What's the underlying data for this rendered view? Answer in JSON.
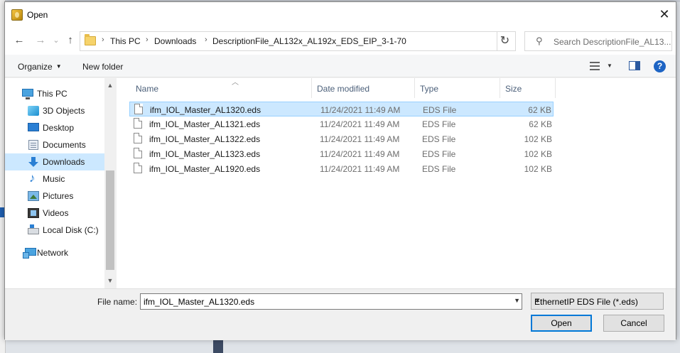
{
  "dialog": {
    "title": "Open",
    "close_glyph": "✕"
  },
  "nav": {
    "back_glyph": "←",
    "forward_glyph": "→",
    "up_glyph": "↑",
    "recent_glyph": "⌄",
    "refresh_glyph": "↻"
  },
  "address": {
    "crumbs": [
      "This PC",
      "Downloads",
      "DescriptionFile_AL132x_AL192x_EDS_EIP_3-1-70"
    ],
    "separator": "›"
  },
  "search": {
    "placeholder": "Search DescriptionFile_AL13...",
    "icon": "search-icon"
  },
  "toolbar": {
    "organize": "Organize",
    "new_folder": "New folder",
    "help": "?"
  },
  "sidebar": {
    "items": [
      {
        "label": "This PC",
        "icon": "computer-icon"
      },
      {
        "label": "3D Objects",
        "icon": "cube-icon"
      },
      {
        "label": "Desktop",
        "icon": "desktop-icon"
      },
      {
        "label": "Documents",
        "icon": "documents-icon"
      },
      {
        "label": "Downloads",
        "icon": "download-icon",
        "selected": true
      },
      {
        "label": "Music",
        "icon": "music-icon"
      },
      {
        "label": "Pictures",
        "icon": "pictures-icon"
      },
      {
        "label": "Videos",
        "icon": "videos-icon"
      },
      {
        "label": "Local Disk (C:)",
        "icon": "disk-icon"
      },
      {
        "label": "Network",
        "icon": "network-icon"
      }
    ]
  },
  "columns": {
    "name": "Name",
    "date": "Date modified",
    "type": "Type",
    "size": "Size"
  },
  "files": [
    {
      "name": "ifm_IOL_Master_AL1320.eds",
      "date": "11/24/2021 11:49 AM",
      "type": "EDS File",
      "size": "62 KB",
      "selected": true
    },
    {
      "name": "ifm_IOL_Master_AL1321.eds",
      "date": "11/24/2021 11:49 AM",
      "type": "EDS File",
      "size": "62 KB"
    },
    {
      "name": "ifm_IOL_Master_AL1322.eds",
      "date": "11/24/2021 11:49 AM",
      "type": "EDS File",
      "size": "102 KB"
    },
    {
      "name": "ifm_IOL_Master_AL1323.eds",
      "date": "11/24/2021 11:49 AM",
      "type": "EDS File",
      "size": "102 KB"
    },
    {
      "name": "ifm_IOL_Master_AL1920.eds",
      "date": "11/24/2021 11:49 AM",
      "type": "EDS File",
      "size": "102 KB"
    }
  ],
  "bottom": {
    "file_name_label": "File name:",
    "file_name_value": "ifm_IOL_Master_AL1320.eds",
    "file_type": "EthernetIP EDS File (*.eds)",
    "open": "Open",
    "cancel": "Cancel"
  },
  "colors": {
    "selection": "#cce8ff",
    "accent": "#0078d7",
    "header_text": "#4c607a"
  }
}
